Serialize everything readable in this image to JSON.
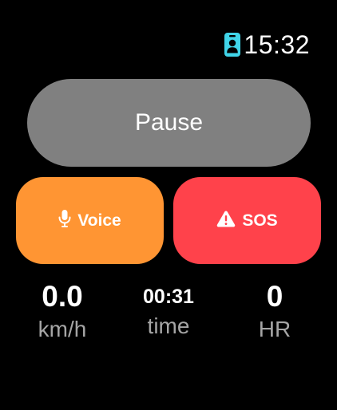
{
  "status": {
    "time": "15:32",
    "icon": "person-badge-icon"
  },
  "controls": {
    "pause_label": "Pause",
    "voice_label": "Voice",
    "voice_icon": "microphone-icon",
    "sos_label": "SOS",
    "sos_icon": "warning-icon"
  },
  "metrics": [
    {
      "value": "0.0",
      "unit": "km/h"
    },
    {
      "value": "00:31",
      "unit": "time"
    },
    {
      "value": "0",
      "unit": "HR"
    }
  ],
  "colors": {
    "background": "#000000",
    "pause_button": "#808080",
    "voice_button": "#FF9533",
    "sos_button": "#FF424B",
    "badge_icon": "#40D4E8",
    "label_gray": "#A5A5A5",
    "text": "#FFFFFF"
  }
}
